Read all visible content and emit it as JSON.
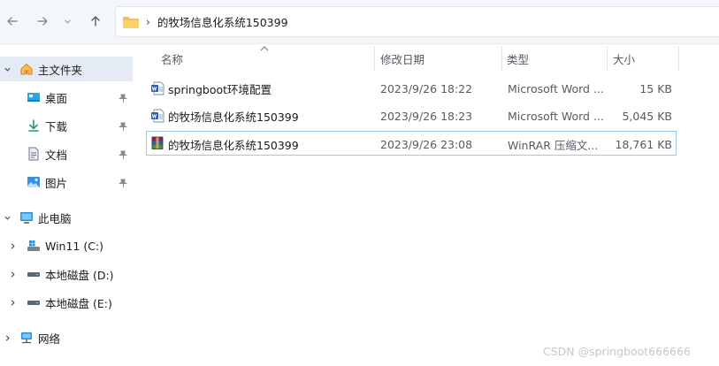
{
  "address": {
    "path": "的牧场信息化系统150399",
    "separator": "›"
  },
  "nav": {
    "back": "back-arrow-icon",
    "forward": "forward-arrow-icon",
    "recent": "chevron-down-icon",
    "up": "up-arrow-icon"
  },
  "sidebar": {
    "home": "主文件夹",
    "quick": [
      {
        "label": "桌面"
      },
      {
        "label": "下载"
      },
      {
        "label": "文档"
      },
      {
        "label": "图片"
      }
    ],
    "pc": "此电脑",
    "drives": [
      {
        "label": "Win11 (C:)"
      },
      {
        "label": "本地磁盘 (D:)"
      },
      {
        "label": "本地磁盘 (E:)"
      }
    ],
    "network": "网络"
  },
  "columns": {
    "name": "名称",
    "date": "修改日期",
    "type": "类型",
    "size": "大小"
  },
  "files": [
    {
      "name": "springboot环境配置",
      "date": "2023/9/26 18:22",
      "type": "Microsoft Word ...",
      "size": "15 KB",
      "icon": "word-doc-icon"
    },
    {
      "name": "的牧场信息化系统150399",
      "date": "2023/9/26 18:23",
      "type": "Microsoft Word ...",
      "size": "5,045 KB",
      "icon": "word-doc-icon"
    },
    {
      "name": "的牧场信息化系统150399",
      "date": "2023/9/26 23:08",
      "type": "WinRAR 压缩文...",
      "size": "18,761 KB",
      "icon": "winrar-archive-icon"
    }
  ],
  "watermark": "CSDN @springboot666666",
  "colors": {
    "accent": "#1e90e6",
    "selection_border": "#99c9ef",
    "folder": "#f4c142"
  }
}
